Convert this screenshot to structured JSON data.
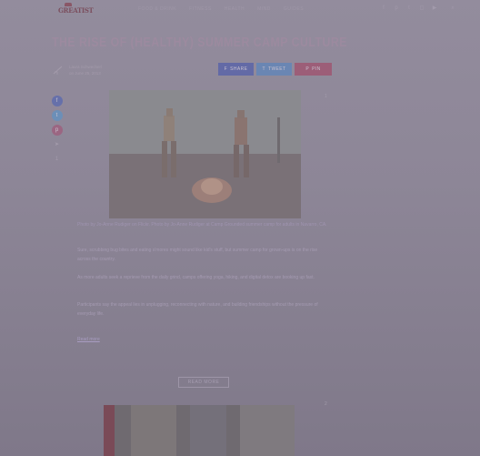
{
  "nav": {
    "logo": "GREATIST",
    "menu": [
      "FOOD &amp; DRINK",
      "FITNESS",
      "HEALTH",
      "MIND",
      "GUIDES"
    ],
    "social_icons": [
      "facebook-icon",
      "pinterest-icon",
      "twitter-icon",
      "instagram-icon",
      "youtube-icon"
    ],
    "search_icon": "search-icon"
  },
  "article": {
    "title": "THE RISE OF (HEALTHY) SUMMER CAMP CULTURE",
    "byline_author": "Laura Schwecherl",
    "byline_date": "on June 25, 2013",
    "share_facebook": "SHARE",
    "share_twitter": "TWEET",
    "share_pinterest": "PIN",
    "share_count": "1",
    "hero_caption": "Photo by Jo-Anne Rudiger on Flickr. Photo by Jo-Anne Rudiger at Camp Grounded summer camp for adults in Navarro, CA.",
    "paragraphs": [
      "Sure, scrubbing bug bites and eating s'mores might sound like kid's stuff, but summer camp for grown-ups is on the rise across the country.",
      "As more adults seek a reprieve from the daily grind, camps offering yoga, hiking, and digital detox are booking up fast.",
      "Participants say the appeal lies in unplugging, reconnecting with nature, and building friendships without the pressure of everyday life.",
      "Read more"
    ],
    "read_more": "READ MORE",
    "bottom_count": "2"
  },
  "colors": {
    "facebook": "#636aa6",
    "twitter": "#6a86b3",
    "pinterest": "#9c5e78"
  }
}
